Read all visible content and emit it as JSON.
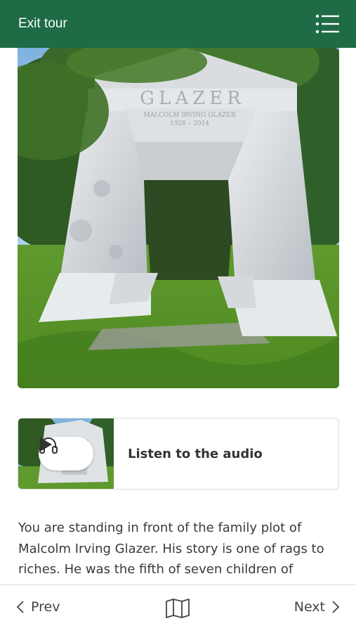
{
  "header": {
    "exit_label": "Exit tour",
    "menu_icon": "hamburger-menu-icon",
    "background": "#1e6b45"
  },
  "hero_image": {
    "inscription_name": "GLAZER",
    "inscription_person": "MALCOLM IRVING GLAZER",
    "inscription_years": "1928 – 2014"
  },
  "audio": {
    "label": "Listen to the audio",
    "icons": [
      "headphones-icon",
      "play-icon"
    ]
  },
  "body": {
    "text": "You are standing in front of the family plot of Malcolm Irving Glazer. His story is one of rags to riches. He was the fifth of seven children of"
  },
  "footer": {
    "prev_label": "Prev",
    "next_label": "Next",
    "map_icon": "map-icon"
  }
}
